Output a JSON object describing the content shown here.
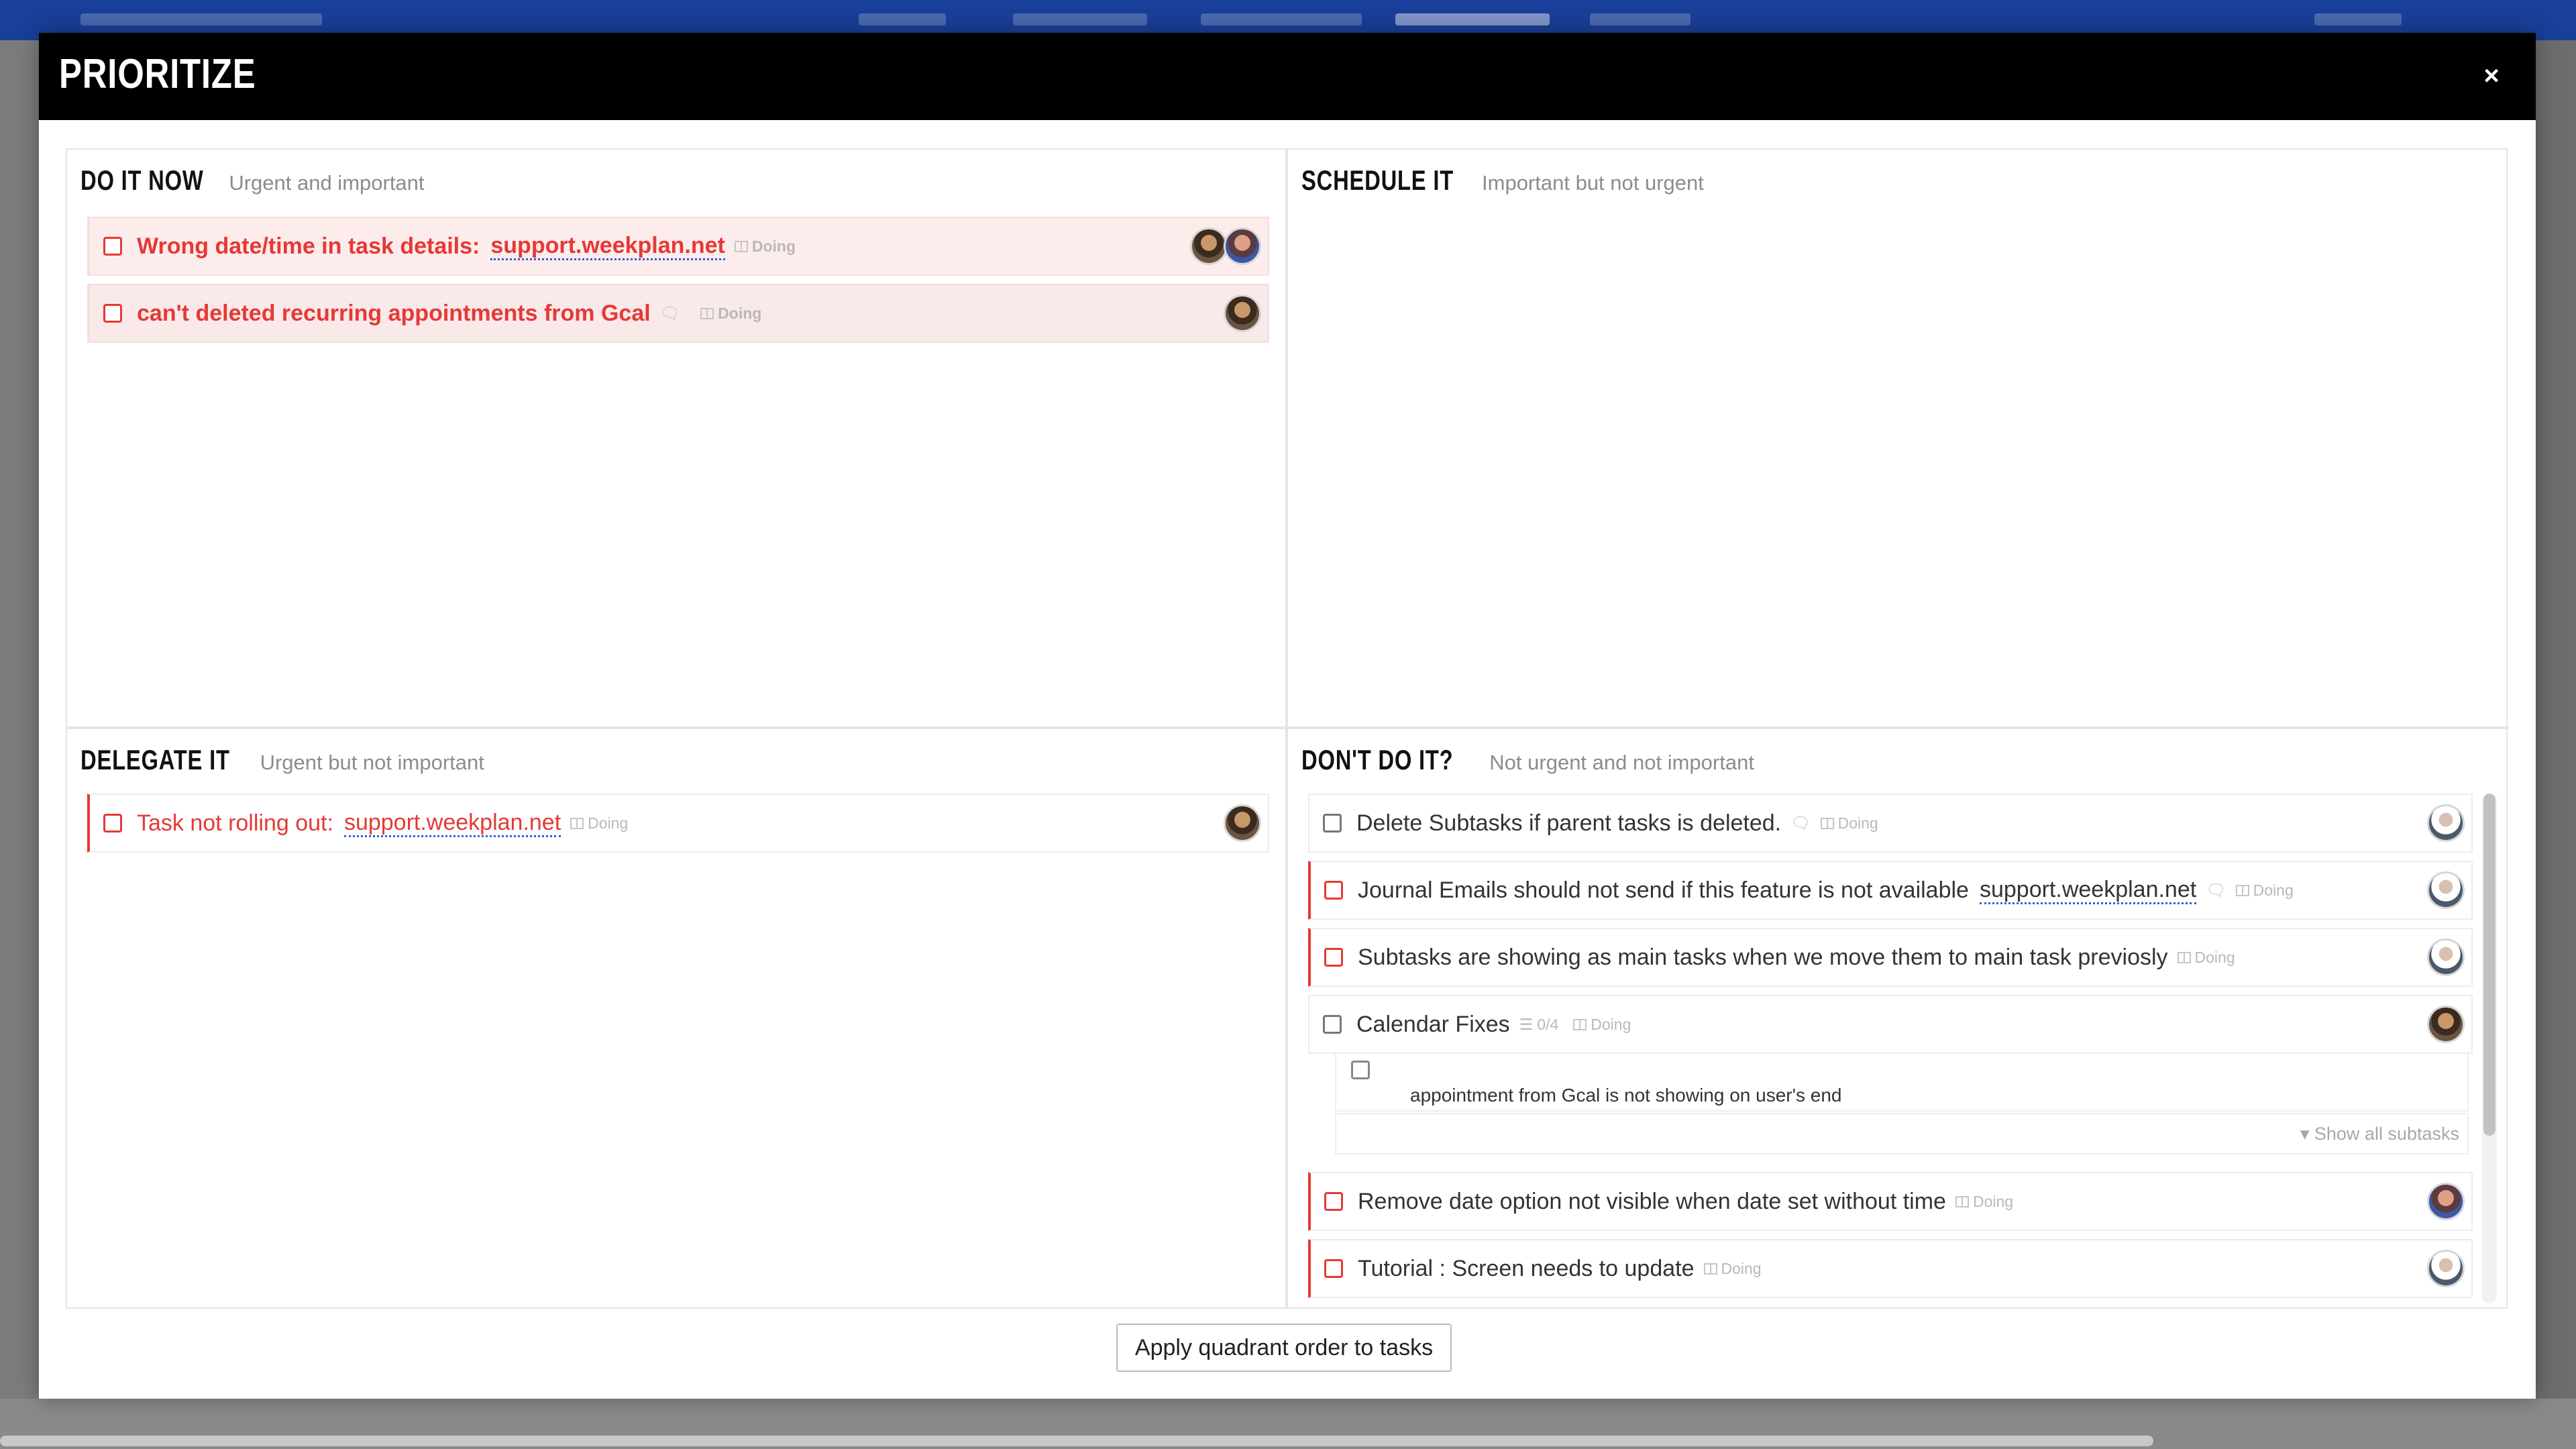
{
  "modal": {
    "title": "PRIORITIZE",
    "close_icon": "×",
    "apply_button": "Apply quadrant order to tasks"
  },
  "quadrants": {
    "do_it_now": {
      "title": "DO IT NOW",
      "subtitle": "Urgent and important",
      "tasks": [
        {
          "name": "Wrong date/time in task details:",
          "link": "support.weekplan.net",
          "status": "Doing",
          "avatars": [
            "brown",
            "blue"
          ]
        },
        {
          "name": "can't deleted recurring appointments from Gcal",
          "status": "Doing",
          "has_comment": true,
          "avatars": [
            "brown"
          ]
        }
      ]
    },
    "schedule_it": {
      "title": "SCHEDULE IT",
      "subtitle": "Important but not urgent",
      "tasks": []
    },
    "delegate_it": {
      "title": "DELEGATE IT",
      "subtitle": "Urgent but not important",
      "tasks": [
        {
          "name": "Task not rolling out:",
          "link": "support.weekplan.net",
          "status": "Doing",
          "avatars": [
            "brown"
          ]
        }
      ]
    },
    "dont_do_it": {
      "title": "DON'T DO IT?",
      "subtitle": "Not urgent and not important",
      "tasks": [
        {
          "name": "Delete Subtasks if parent tasks is deleted.",
          "status": "Doing",
          "has_comment": true,
          "avatars": [
            "white"
          ]
        },
        {
          "name": "Journal Emails should not send if this feature is not available",
          "link": "support.weekplan.net",
          "status": "Doing",
          "has_comment": true,
          "avatars": [
            "white"
          ]
        },
        {
          "name": "Subtasks are showing as main tasks when we move them to main task previosly",
          "status": "Doing",
          "avatars": [
            "white"
          ]
        },
        {
          "name": "Calendar Fixes",
          "subtask_count": "0/4",
          "status": "Doing",
          "avatars": [
            "brown"
          ],
          "subtasks": [
            {
              "name": "appointment from Gcal is not showing on user's end"
            }
          ],
          "show_all": "Show all subtasks"
        },
        {
          "name": "Remove date option not visible when date set without time",
          "status": "Doing",
          "avatars": [
            "blue"
          ]
        },
        {
          "name": "Tutorial : Screen needs to update",
          "status": "Doing",
          "avatars": [
            "white"
          ]
        }
      ]
    }
  },
  "colors": {
    "accent_red": "#e53935",
    "header_bg": "#000000",
    "link_underline": "#2a63d8"
  },
  "icons": [
    "close-icon",
    "checkbox-icon",
    "board-icon",
    "comment-icon",
    "subtask-list-icon",
    "caret-down-icon",
    "avatar"
  ]
}
